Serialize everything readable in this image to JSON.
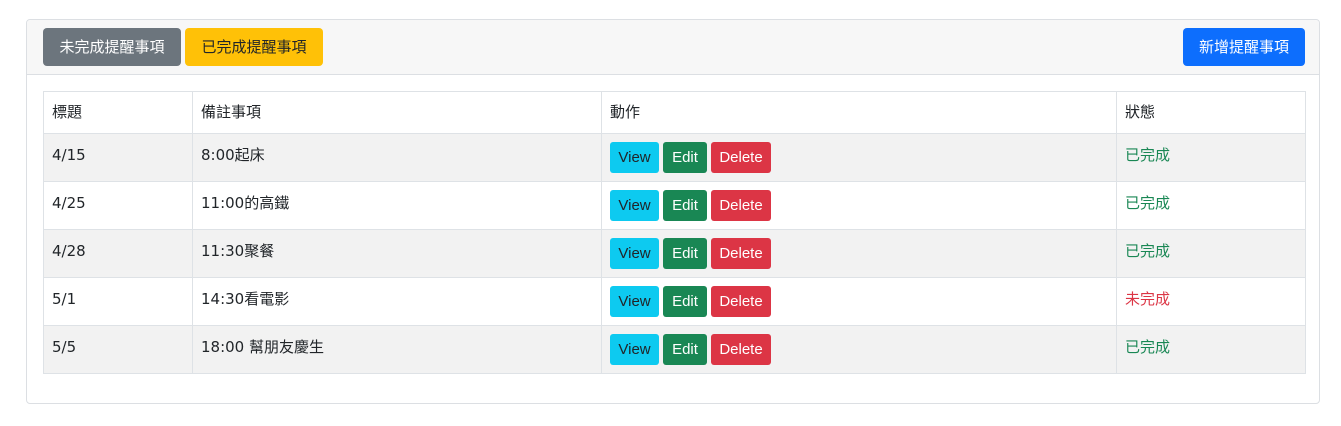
{
  "header": {
    "incomplete_tab": "未完成提醒事項",
    "complete_tab": "已完成提醒事項",
    "add_button": "新增提醒事項"
  },
  "table": {
    "columns": [
      "標題",
      "備註事項",
      "動作",
      "狀態"
    ],
    "action_labels": {
      "view": "View",
      "edit": "Edit",
      "delete": "Delete"
    },
    "rows": [
      {
        "title": "4/15",
        "note": "8:00起床",
        "status": "已完成",
        "status_type": "done"
      },
      {
        "title": "4/25",
        "note": "11:00的高鐵",
        "status": "已完成",
        "status_type": "done"
      },
      {
        "title": "4/28",
        "note": "11:30聚餐",
        "status": "已完成",
        "status_type": "done"
      },
      {
        "title": "5/1",
        "note": "14:30看電影",
        "status": "未完成",
        "status_type": "todo"
      },
      {
        "title": "5/5",
        "note": "18:00 幫朋友慶生",
        "status": "已完成",
        "status_type": "done"
      }
    ]
  },
  "colors": {
    "secondary": "#6c757d",
    "warning": "#ffc107",
    "primary": "#0d6efd",
    "info": "#0dcaf0",
    "success": "#198754",
    "danger": "#dc3545"
  }
}
